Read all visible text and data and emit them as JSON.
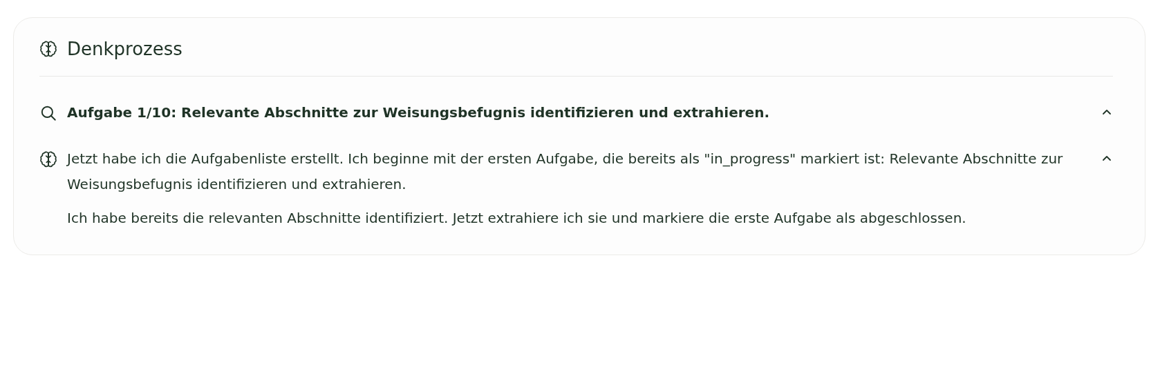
{
  "panel": {
    "title": "Denkprozess"
  },
  "steps": [
    {
      "kind": "task",
      "expanded": true,
      "paragraphs": [
        "Aufgabe 1/10: Relevante Abschnitte zur Weisungsbefugnis identifizieren und extrahieren."
      ]
    },
    {
      "kind": "thought",
      "expanded": true,
      "paragraphs": [
        "Jetzt habe ich die Aufgabenliste erstellt. Ich beginne mit der ersten Aufgabe, die bereits als \"in_progress\" markiert ist: Relevante Abschnitte zur Weisungsbefugnis identifizieren und extrahieren.",
        "Ich habe bereits die relevanten Abschnitte identifiziert. Jetzt extrahiere ich sie und markiere die erste Aufgabe als abgeschlossen."
      ]
    }
  ]
}
